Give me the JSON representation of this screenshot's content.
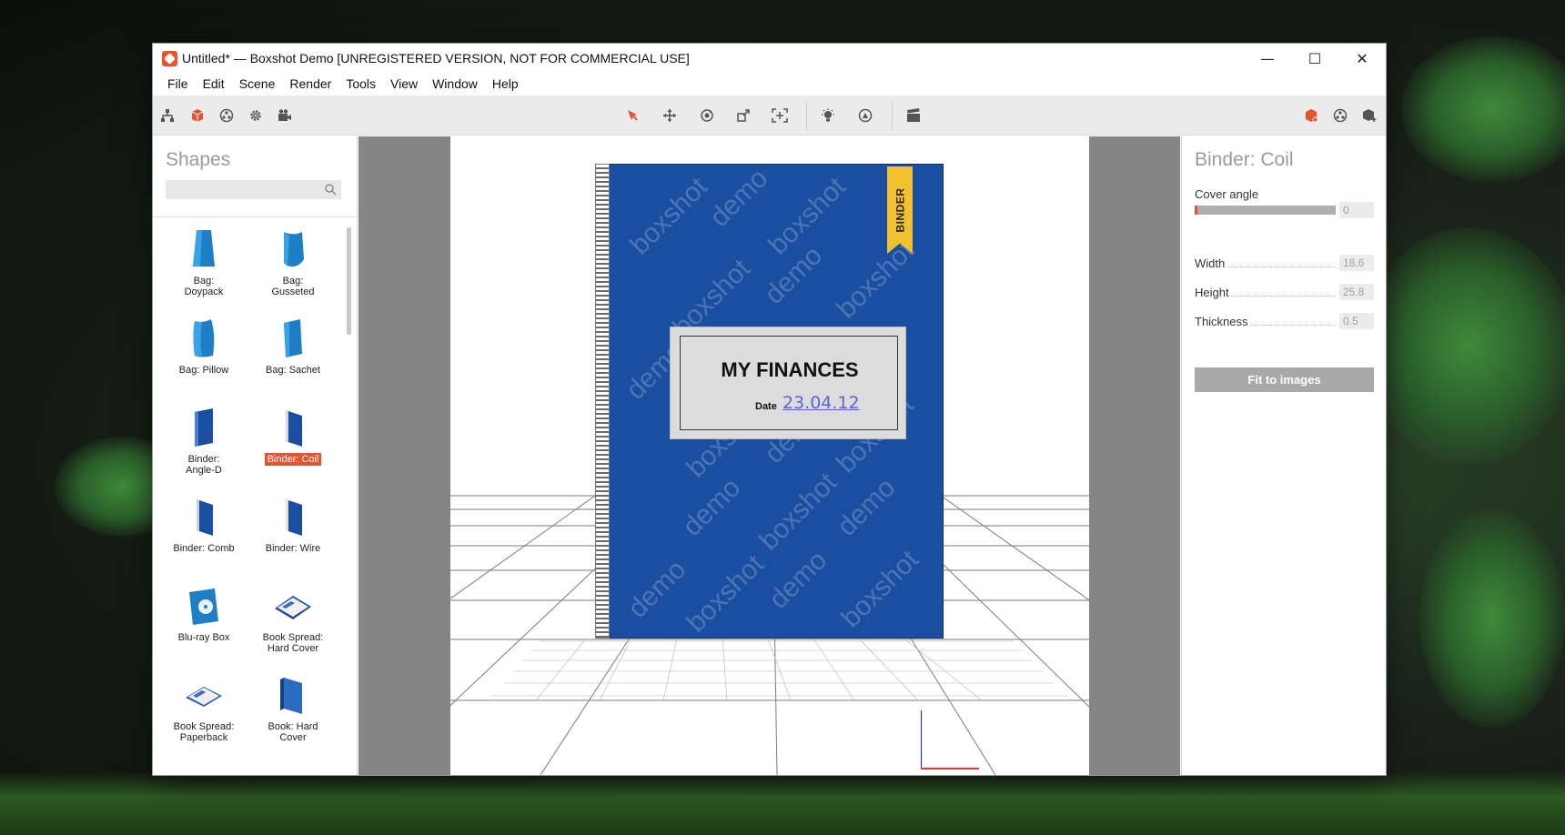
{
  "window": {
    "title": "Untitled* — Boxshot Demo [UNREGISTERED VERSION, NOT FOR COMMERCIAL USE]",
    "controls": {
      "minimize": "—",
      "maximize": "☐",
      "close": "✕"
    }
  },
  "menu": [
    "File",
    "Edit",
    "Scene",
    "Render",
    "Tools",
    "View",
    "Window",
    "Help"
  ],
  "toolbar": {
    "left": [
      "scene-tree-icon",
      "shapes-icon",
      "materials-icon",
      "settings-icon",
      "camera-icon"
    ],
    "center": [
      "select-icon",
      "move-icon",
      "rotate-icon",
      "scale-icon",
      "fit-icon"
    ],
    "center2": [
      "light-icon",
      "environment-icon"
    ],
    "center3": [
      "render-icon"
    ],
    "right": [
      "object-icon",
      "material-ball-icon",
      "add-object-icon"
    ],
    "accent": "#e5532f"
  },
  "shapes_panel": {
    "title": "Shapes",
    "search_placeholder": "",
    "items": [
      {
        "label": "Bag:\nDoypack",
        "line1": "Bag:",
        "line2": "Doypack",
        "selected": false
      },
      {
        "label": "Bag: Gusseted",
        "line1": "Bag:",
        "line2": "Gusseted",
        "selected": false
      },
      {
        "label": "Bag: Pillow",
        "line1": "Bag: Pillow",
        "line2": "",
        "selected": false
      },
      {
        "label": "Bag: Sachet",
        "line1": "Bag: Sachet",
        "line2": "",
        "selected": false
      },
      {
        "label": "Binder: Angle-D",
        "line1": "Binder:",
        "line2": "Angle-D",
        "selected": false
      },
      {
        "label": "Binder: Coil",
        "line1": "Binder: Coil",
        "line2": "",
        "selected": true
      },
      {
        "label": "Binder: Comb",
        "line1": "Binder: Comb",
        "line2": "",
        "selected": false
      },
      {
        "label": "Binder: Wire",
        "line1": "Binder: Wire",
        "line2": "",
        "selected": false
      },
      {
        "label": "Blu-ray Box",
        "line1": "Blu-ray Box",
        "line2": "",
        "selected": false
      },
      {
        "label": "Book Spread: Hard Cover",
        "line1": "Book Spread:",
        "line2": "Hard Cover",
        "selected": false
      },
      {
        "label": "Book Spread: Paperback",
        "line1": "Book Spread:",
        "line2": "Paperback",
        "selected": false
      },
      {
        "label": "Book: Hard Cover",
        "line1": "Book: Hard",
        "line2": "Cover",
        "selected": false
      }
    ]
  },
  "viewport": {
    "cover": {
      "ribbon": "BINDER",
      "title": "MY FINANCES",
      "date_caption": "Date",
      "date_value": "23.04.12",
      "watermark_1": "boxshot",
      "watermark_2": "demo",
      "color": "#1a4ea0"
    }
  },
  "properties": {
    "title": "Binder: Coil",
    "cover_angle_label": "Cover angle",
    "cover_angle_value": "0",
    "cover_angle_fraction": 0.02,
    "width_label": "Width",
    "width_value": "18.6",
    "height_label": "Height",
    "height_value": "25.8",
    "thickness_label": "Thickness",
    "thickness_value": "0.5",
    "fit_button": "Fit to images"
  }
}
